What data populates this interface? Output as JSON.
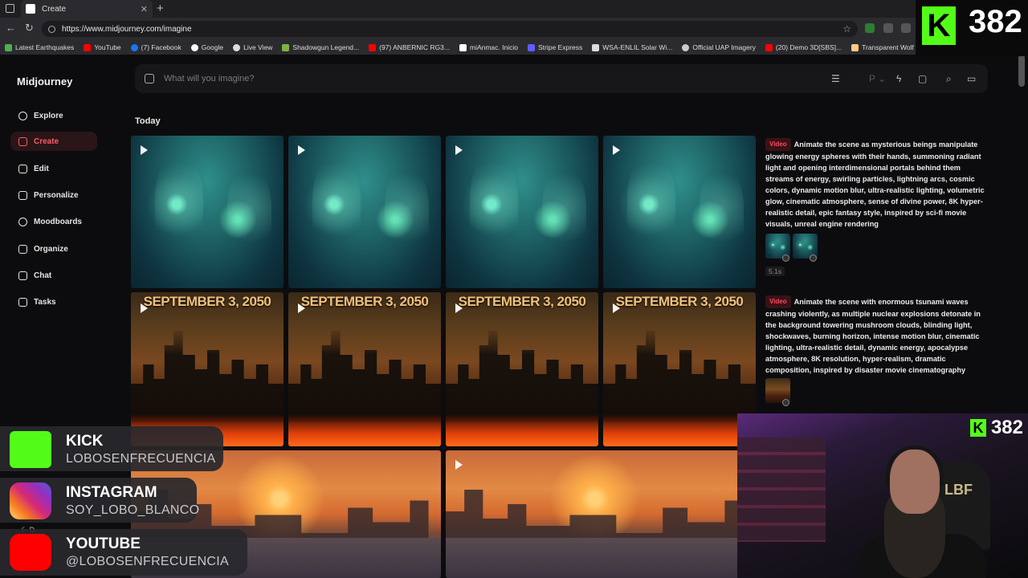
{
  "browser": {
    "tab_title": "Create",
    "url": "https://www.midjourney.com/imagine",
    "bookmarks": [
      {
        "label": "Latest Earthquakes",
        "color": "#4caf50"
      },
      {
        "label": "YouTube",
        "color": "#ff0000"
      },
      {
        "label": "(7) Facebook",
        "color": "#1877f2"
      },
      {
        "label": "Google",
        "color": "#ffffff"
      },
      {
        "label": "Live View",
        "color": "#dddddd"
      },
      {
        "label": "Shadowgun Legend...",
        "color": "#7cb342"
      },
      {
        "label": "(97) ANBERNIC RG3...",
        "color": "#ff0000"
      },
      {
        "label": "miAnmac. Inicio",
        "color": "#ffffff"
      },
      {
        "label": "Stripe Express",
        "color": "#635bff"
      },
      {
        "label": "WSA-ENLIL Solar Wi...",
        "color": "#dddddd"
      },
      {
        "label": "Official UAP Imagery",
        "color": "#cccccc"
      },
      {
        "label": "(20) Demo 3D[SBS]...",
        "color": "#ff0000"
      },
      {
        "label": "Transparent Wolf Gl...",
        "color": "#ffcc80"
      }
    ]
  },
  "app": {
    "logo": "Midjourney",
    "nav": [
      {
        "label": "Explore",
        "icon": "compass-icon"
      },
      {
        "label": "Create",
        "icon": "brush-icon"
      },
      {
        "label": "Edit",
        "icon": "edit-icon"
      },
      {
        "label": "Personalize",
        "icon": "personalize-icon"
      },
      {
        "label": "Moodboards",
        "icon": "moodboard-icon"
      },
      {
        "label": "Organize",
        "icon": "grid-icon"
      },
      {
        "label": "Chat",
        "icon": "chat-icon"
      },
      {
        "label": "Tasks",
        "icon": "tasks-icon"
      }
    ],
    "active_color": "#ff5a6a",
    "prompt_placeholder": "What will you imagine?",
    "section_title": "Today",
    "row1_caption": "SEPTEMBER 3, 2050",
    "job1": {
      "badge": "Video",
      "text": "Animate the scene as mysterious beings manipulate glowing energy spheres with their hands, summoning radiant light and opening interdimensional portals behind them streams of energy, swirling particles, lightning arcs, cosmic colors, dynamic motion blur, ultra-realistic lighting, volumetric glow, cinematic atmosphere, sense of divine power, 8K hyper-realistic detail, epic fantasy style, inspired by sci-fi movie visuals, unreal engine rendering",
      "duration": "5.1s"
    },
    "job2": {
      "badge": "Video",
      "text": "Animate the scene with enormous tsunami waves crashing violently, as multiple nuclear explosions detonate in the background towering mushroom clouds, blinding light, shockwaves, burning horizon, intense motion blur, cinematic lighting, ultra-realistic detail, dynamic energy, apocalypse atmosphere, 8K resolution, hyper-realism, dramatic composition, inspired by disaster movie cinematography"
    }
  },
  "overlay": {
    "kick_count": "382",
    "kick_letter": "K",
    "socials": [
      {
        "title": "KICK",
        "handle": "LOBOSENFRECUENCIA",
        "color": "#53fc18"
      },
      {
        "title": "INSTAGRAM",
        "handle": "SOY_LOBO_BLANCO",
        "color": "#dd2a7b"
      },
      {
        "title": "YOUTUBE",
        "handle": "@LOBOSENFRECUENCIA",
        "color": "#ff0000"
      }
    ],
    "chair_logo": "LBF",
    "hidden_letter": "D"
  }
}
